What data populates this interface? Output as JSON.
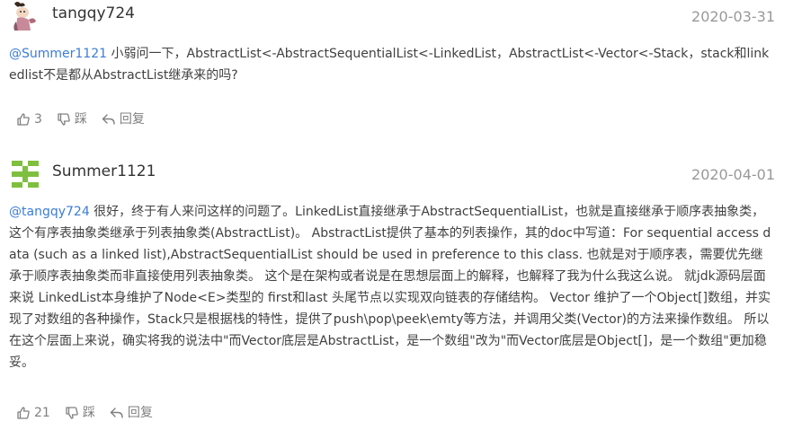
{
  "comments": [
    {
      "username": "tangqy724",
      "date": "2020-03-31",
      "mention": "@Summer1121",
      "text": " 小弱问一下，AbstractList<-AbstractSequentialList<-LinkedList，AbstractList<-Vector<-Stack，stack和linkedlist不是都从AbstractList继承来的吗?",
      "actions": {
        "like_count": "3",
        "dislike_label": "踩",
        "reply_label": "回复"
      },
      "avatar_icon": "cartoon-character-avatar"
    },
    {
      "username": "Summer1121",
      "date": "2020-04-01",
      "mention": "@tangqy724",
      "text": " 很好，终于有人来问这样的问题了。LinkedList直接继承于AbstractSequentialList，也就是直接继承于顺序表抽象类，这个有序表抽象类继承于列表抽象类(AbstractList)。 AbstractList提供了基本的列表操作，其的doc中写道：For sequential access data (such as a linked list),AbstractSequentialList should be used in preference to this class. 也就是对于顺序表，需要优先继承于顺序表抽象类而非直接使用列表抽象类。 这个是在架构或者说是在思想层面上的解释，也解释了我为什么我这么说。 就jdk源码层面来说 LinkedList本身维护了Node<E>类型的 first和last 头尾节点以实现双向链表的存储结构。 Vector 维护了一个Object[]数组，并实现了对数组的各种操作，Stack只是根据栈的特性，提供了push\\pop\\peek\\emty等方法，并调用父类(Vector)的方法来操作数组。 所以在这个层面上来说，确实将我的说法中\"而Vector底层是AbstractList，是一个数组\"改为\"而Vector底层是Object[]，是一个数组\"更加稳妥。",
      "actions": {
        "like_count": "21",
        "dislike_label": "踩",
        "reply_label": "回复"
      },
      "avatar_icon": "green-identicon-avatar"
    }
  ],
  "colors": {
    "mention": "#3b7dd8",
    "text": "#404040",
    "muted": "#999999",
    "identicon": "#7fbf3f"
  }
}
